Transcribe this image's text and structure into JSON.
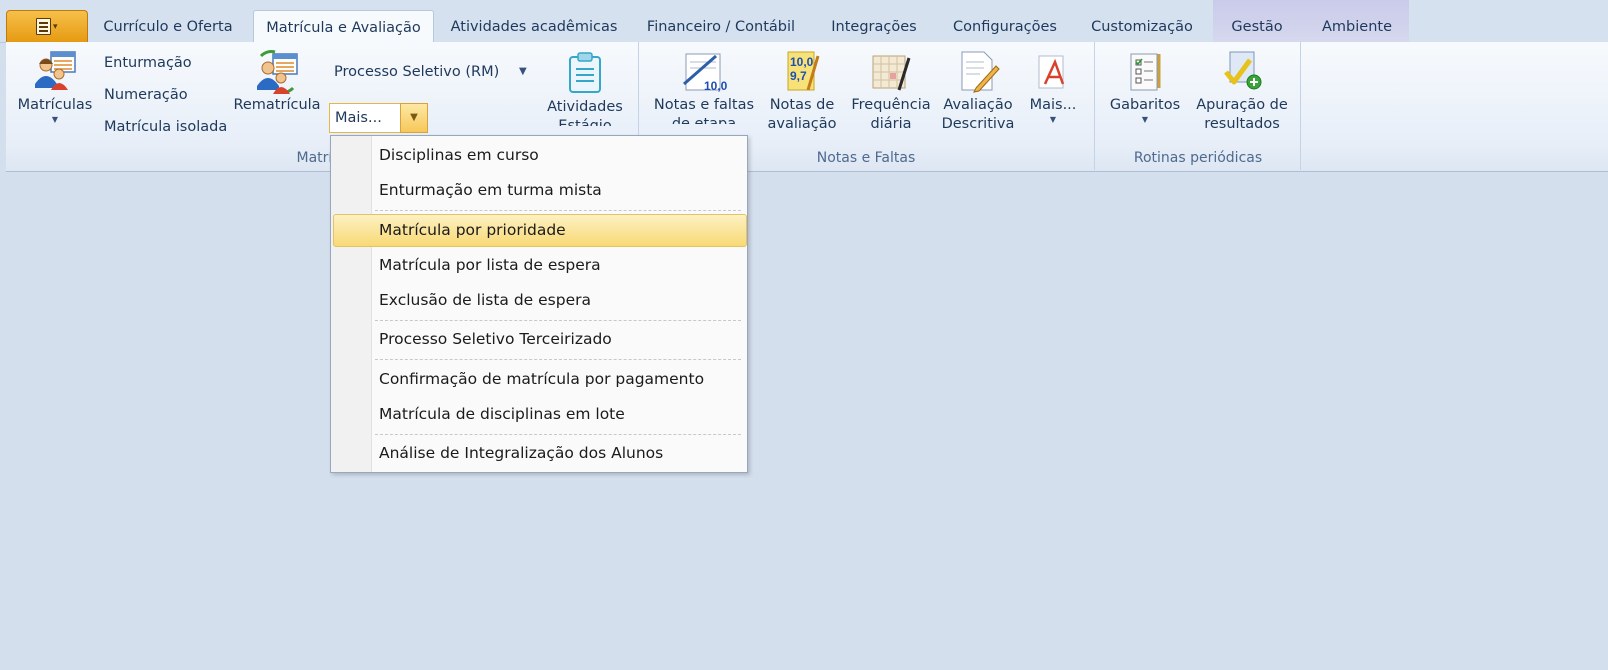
{
  "tabs": {
    "curriculo": "Currículo e Oferta",
    "matricula": "Matrícula e Avaliação",
    "atividades": "Atividades acadêmicas",
    "financeiro": "Financeiro / Contábil",
    "integracoes": "Integrações",
    "configuracoes": "Configurações",
    "customizacao": "Customização",
    "gestao": "Gestão",
    "ambiente": "Ambiente"
  },
  "ribbon": {
    "matriculas": "Matrículas",
    "enturmacao": "Enturmação",
    "numeracao": "Numeração",
    "matricula_isolada": "Matrícula isolada",
    "rematricula": "Rematrícula",
    "processo_seletivo": "Processo Seletivo (RM)",
    "mais_combo": "Mais...",
    "atividades_line1": "Atividades",
    "atividades_line2": "Estágio",
    "group_matricula": "Matríc",
    "notas_faltas_line1": "Notas e faltas",
    "notas_faltas_line2": "de etapa",
    "notas_avaliacao_line1": "Notas de",
    "notas_avaliacao_line2": "avaliação",
    "frequencia_line1": "Frequência",
    "frequencia_line2": "diária",
    "avaliacao_line1": "Avaliação",
    "avaliacao_line2": "Descritiva",
    "mais_notas": "Mais...",
    "group_notas": "Notas e Faltas",
    "gabaritos": "Gabaritos",
    "apuracao_line1": "Apuração de",
    "apuracao_line2": "resultados",
    "group_rotinas": "Rotinas periódicas",
    "icon_nota": "10,0",
    "icon_nota2a": "10,0",
    "icon_nota2b": "9,7"
  },
  "menu": {
    "items": [
      "Disciplinas em curso",
      "Enturmação em turma mista",
      "Matrícula por prioridade",
      "Matrícula por lista de espera",
      "Exclusão de lista de espera",
      "Processo Seletivo Terceirizado",
      "Confirmação de matrícula por pagamento",
      "Matrícula de disciplinas em lote",
      "Análise de Integralização dos Alunos"
    ],
    "highlighted": "Matrícula por prioridade"
  },
  "colors": {
    "accent": "#f7c85a",
    "background": "#d4dfee",
    "text": "#1e395b"
  }
}
